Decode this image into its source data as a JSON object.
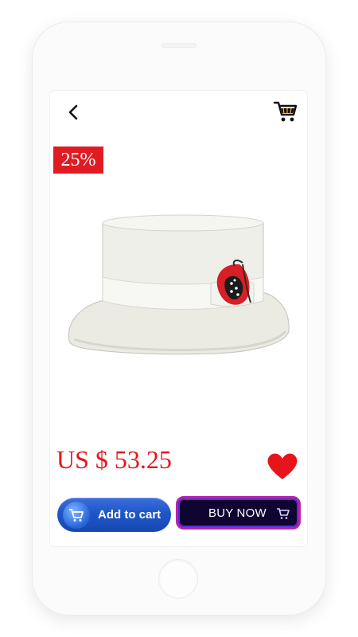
{
  "product": {
    "discount_badge": "25%",
    "price": "US $ 53.25",
    "image_description_icon": "hat-image"
  },
  "actions": {
    "add_to_cart_label": "Add to cart",
    "buy_now_label": "BUY NOW"
  },
  "icons": {
    "back": "chevron-left-icon",
    "cart": "shopping-cart-icon",
    "favorite": "heart-icon"
  },
  "colors": {
    "accent_red": "#e11b22",
    "add_cart_blue": "#1e56c9",
    "buy_now_bg": "#0f0530",
    "buy_now_border": "#b624a8"
  }
}
